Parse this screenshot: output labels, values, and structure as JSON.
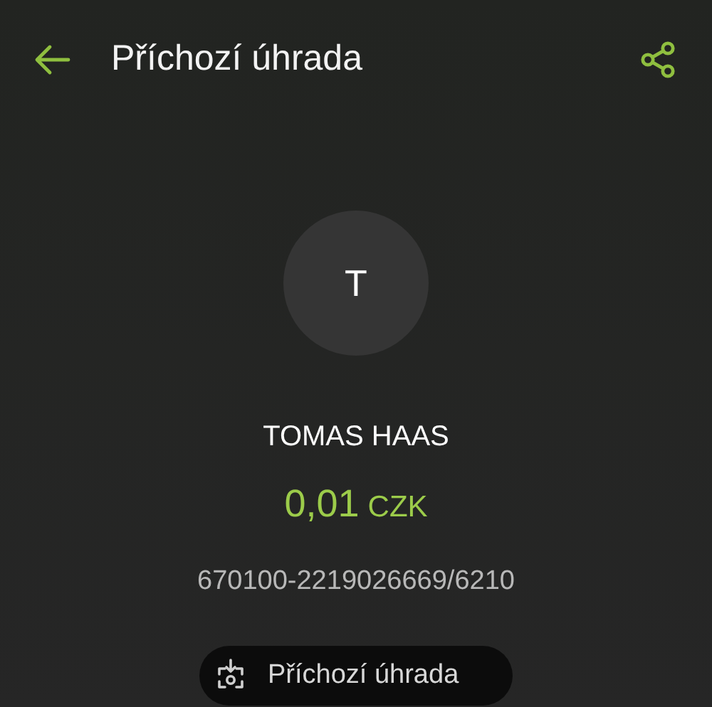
{
  "header": {
    "title": "Příchozí úhrada"
  },
  "avatar": {
    "initial": "T"
  },
  "counterparty": {
    "name": "TOMAS HAAS",
    "amount": "0,01",
    "currency": "CZK",
    "account": "670100-2219026669/6210"
  },
  "type_chip": {
    "label": "Příchozí úhrada"
  }
}
